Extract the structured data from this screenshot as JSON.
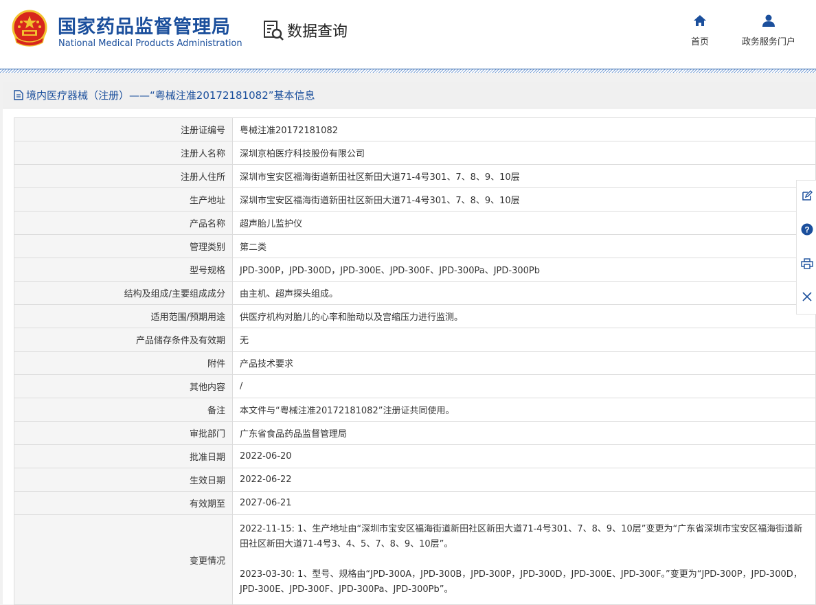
{
  "header": {
    "org_cn": "国家药品监督管理局",
    "org_en": "National Medical Products Administration",
    "query_label": "数据查询",
    "nav": [
      {
        "label": "首页",
        "icon": "home-icon"
      },
      {
        "label": "政务服务门户",
        "icon": "user-icon"
      }
    ]
  },
  "page_title": "境内医疗器械（注册）——“粤械注准20172181082”基本信息",
  "rows": [
    {
      "k": "注册证编号",
      "v": "粤械注准20172181082"
    },
    {
      "k": "注册人名称",
      "v": "深圳京柏医疗科技股份有限公司"
    },
    {
      "k": "注册人住所",
      "v": "深圳市宝安区福海街道新田社区新田大道71-4号301、7、8、9、10层"
    },
    {
      "k": "生产地址",
      "v": "深圳市宝安区福海街道新田社区新田大道71-4号301、7、8、9、10层"
    },
    {
      "k": "产品名称",
      "v": "超声胎儿监护仪"
    },
    {
      "k": "管理类别",
      "v": "第二类"
    },
    {
      "k": "型号规格",
      "v": "JPD-300P，JPD-300D，JPD-300E、JPD-300F、JPD-300Pa、JPD-300Pb"
    },
    {
      "k": "结构及组成/主要组成成分",
      "v": "由主机、超声探头组成。"
    },
    {
      "k": "适用范围/预期用途",
      "v": "供医疗机构对胎儿的心率和胎动以及宫缩压力进行监测。"
    },
    {
      "k": "产品储存条件及有效期",
      "v": "无"
    },
    {
      "k": "附件",
      "v": "产品技术要求"
    },
    {
      "k": "其他内容",
      "v": "/"
    },
    {
      "k": "备注",
      "v": "本文件与“粤械注准20172181082”注册证共同使用。"
    },
    {
      "k": "审批部门",
      "v": "广东省食品药品监督管理局"
    },
    {
      "k": "批准日期",
      "v": "2022-06-20"
    },
    {
      "k": "生效日期",
      "v": "2022-06-22"
    },
    {
      "k": "有效期至",
      "v": "2027-06-21"
    }
  ],
  "changes": {
    "k": "变更情况",
    "entries": [
      "2022-11-15: 1、生产地址由“深圳市宝安区福海街道新田社区新田大道71-4号301、7、8、9、10层”变更为“广东省深圳市宝安区福海街道新田社区新田大道71-4号3、4、5、7、8、9、10层”。",
      "2023-03-30: 1、型号、规格由“JPD-300A，JPD-300B，JPD-300P，JPD-300D，JPD-300E、JPD-300F。”变更为“JPD-300P，JPD-300D，JPD-300E、JPD-300F、JPD-300Pa、JPD-300Pb”。"
    ]
  },
  "side_tools": [
    "edit-icon",
    "help-icon",
    "print-icon",
    "close-icon"
  ],
  "colors": {
    "brand": "#1b4f9c",
    "emblem_red": "#d7261c",
    "emblem_gold": "#f2c230"
  }
}
